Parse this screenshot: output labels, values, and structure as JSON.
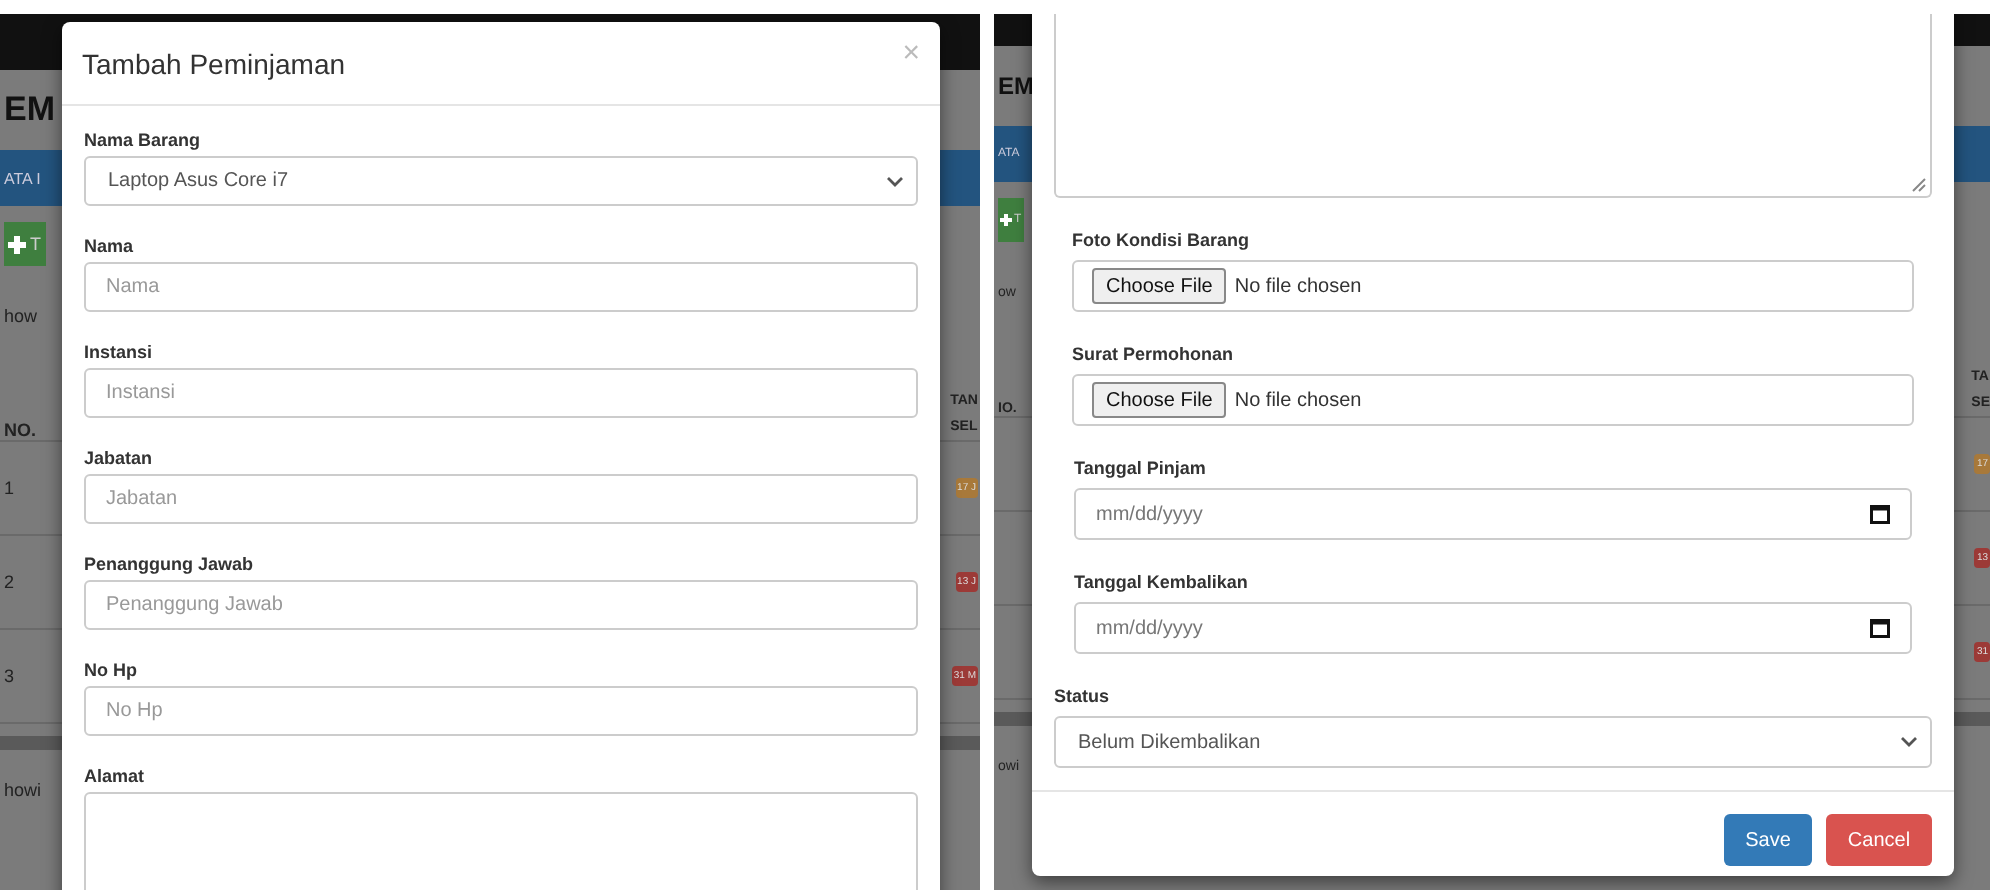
{
  "panels": [
    {
      "background": {
        "heading": "EM",
        "band": "ATA I",
        "add_button": "T",
        "show": "how",
        "header_left": "NO.",
        "header_right": [
          "TAN",
          "SEL"
        ],
        "rows": [
          {
            "number": "1",
            "badge": "17 J",
            "color": "#a8793a"
          },
          {
            "number": "2",
            "badge": "13 J",
            "color": "#9c3a37"
          },
          {
            "number": "3",
            "badge": "31 M",
            "color": "#9c3a37"
          }
        ],
        "footer": "howi"
      },
      "modal": {
        "title": "Tambah Peminjaman",
        "close": "×",
        "fields": [
          {
            "kind": "select",
            "label": "Nama Barang",
            "value": "Laptop Asus Core i7"
          },
          {
            "kind": "text",
            "label": "Nama",
            "placeholder": "Nama"
          },
          {
            "kind": "text",
            "label": "Instansi",
            "placeholder": "Instansi"
          },
          {
            "kind": "text",
            "label": "Jabatan",
            "placeholder": "Jabatan"
          },
          {
            "kind": "text",
            "label": "Penanggung Jawab",
            "placeholder": "Penanggung Jawab"
          },
          {
            "kind": "text",
            "label": "No Hp",
            "placeholder": "No Hp"
          },
          {
            "kind": "textarea",
            "label": "Alamat"
          }
        ]
      }
    },
    {
      "background": {
        "heading": "EM",
        "band": "ATA",
        "add_button": "T",
        "show": "ow",
        "header_left": "IO.",
        "header_right": [
          "TA",
          "SE"
        ],
        "rows": [
          {
            "badge": "17",
            "color": "#a8793a"
          },
          {
            "badge": "13",
            "color": "#9c3a37"
          },
          {
            "badge": "31",
            "color": "#9c3a37"
          }
        ],
        "footer": "owi"
      },
      "modal": {
        "fields": [
          {
            "kind": "textarea"
          },
          {
            "kind": "file",
            "label": "Foto Kondisi Barang",
            "button": "Choose File",
            "status": "No file chosen"
          },
          {
            "kind": "file",
            "label": "Surat Permohonan",
            "button": "Choose File",
            "status": "No file chosen"
          },
          {
            "kind": "date",
            "label": "Tanggal Pinjam",
            "placeholder": "mm/dd/yyyy"
          },
          {
            "kind": "date",
            "label": "Tanggal Kembalikan",
            "placeholder": "mm/dd/yyyy"
          },
          {
            "kind": "select",
            "label": "Status",
            "value": "Belum Dikembalikan"
          }
        ],
        "buttons": [
          {
            "kind": "primary",
            "label": "Save"
          },
          {
            "kind": "danger",
            "label": "Cancel"
          }
        ]
      }
    }
  ]
}
